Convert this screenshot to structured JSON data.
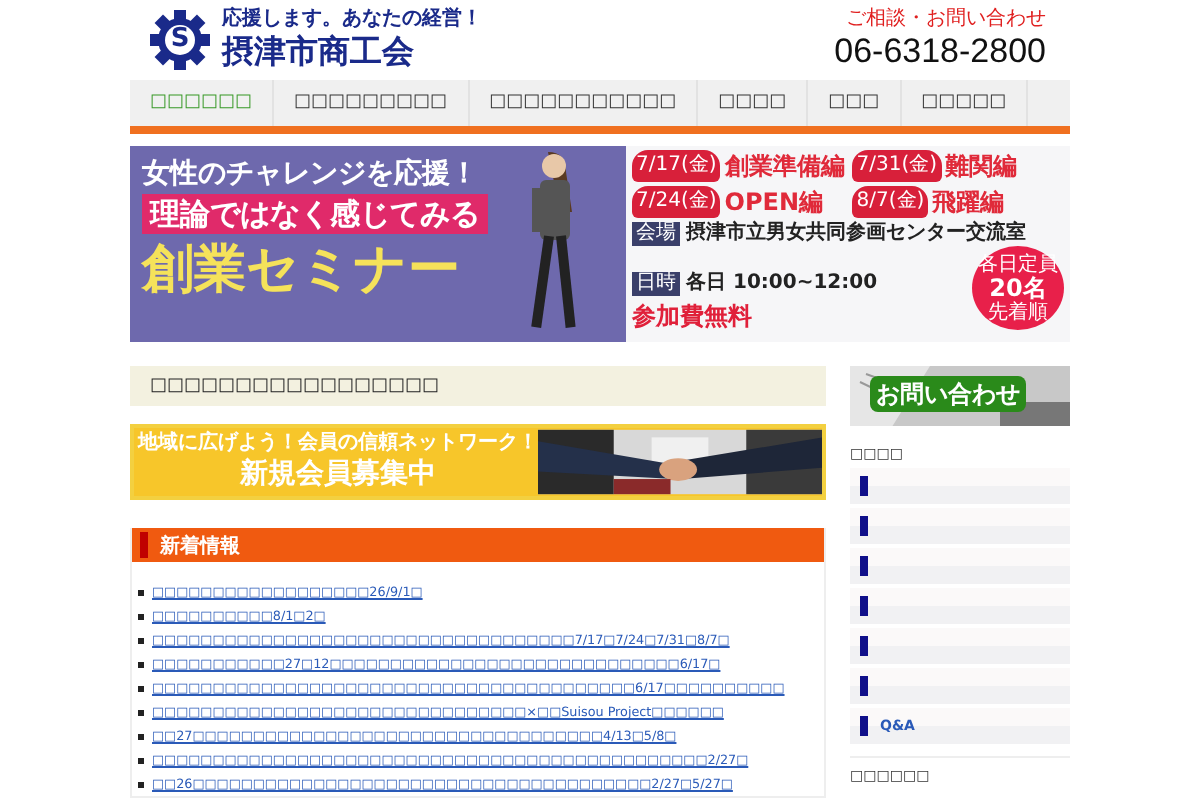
{
  "header": {
    "logo_mark": "S",
    "tagline": "応援します。あなたの経営！",
    "name": "摂津市商工会",
    "contact_label": "ご相談・お問い合わせ",
    "phone": "06-6318-2800"
  },
  "nav": [
    {
      "label": "□□□□□□",
      "selected": true
    },
    {
      "label": "□□□□□□□□□",
      "selected": false
    },
    {
      "label": "□□□□□□□□□□□",
      "selected": false
    },
    {
      "label": "□□□□",
      "selected": false
    },
    {
      "label": "□□□",
      "selected": false
    },
    {
      "label": "□□□□□",
      "selected": false
    }
  ],
  "seminar_banner": {
    "title_lines": [
      "女性のチャレンジを応援！",
      "理論ではなく感じてみる",
      "創業セミナー"
    ],
    "sessions": [
      {
        "date": "7/17(金)",
        "name": "創業準備編"
      },
      {
        "date": "7/31(金)",
        "name": "難関編"
      },
      {
        "date": "7/24(金)",
        "name": "OPEN編"
      },
      {
        "date": "8/7(金)",
        "name": "飛躍編"
      }
    ],
    "venue_label": "会場",
    "venue": "摂津市立男女共同参画センター交流室",
    "time_label": "日時",
    "time": "各日 10:00~12:00",
    "fee": "参加費無料",
    "capacity": [
      "各日定員",
      "20名",
      "先着順"
    ]
  },
  "page_title": "□□□□□□□□□□□□□□□□□",
  "member_banner": {
    "line_1": "地域に広げよう！会員の信頼ネットワーク！",
    "line_2": "新規会員募集中"
  },
  "news": {
    "heading": "新着情報",
    "items": [
      "□□□□□□□□□□□□□□□□□□26/9/1□",
      "□□□□□□□□□□8/1□2□",
      "□□□□□□□□□□□□□□□□□□□□□□□□□□□□□□□□□□□7/17□7/24□7/31□8/7□",
      "□□□□□□□□□□□27□12□□□□□□□□□□□□□□□□□□□□□□□□□□□□□6/17□",
      "□□□□□□□□□□□□□□□□□□□□□□□□□□□□□□□□□□□□□□□□6/17□□□□□□□□□□",
      "□□□□□□□□□□□□□□□□□□□□□□□□□□□□□□□×□□Suisou Project□□□□□□",
      "□□27□□□□□□□□□□□□□□□□□□□□□□□□□□□□□□□□□□4/13□5/8□",
      "□□□□□□□□□□□□□□□□□□□□□□□□□□□□□□□□□□□□□□□□□□□□□□2/27□",
      "□□26□□□□□□□□□□□□□□□□□□□□□□□□□□□□□□□□□□□□□□2/27□5/27□"
    ]
  },
  "sidebar": {
    "contact_button": "お問い合わせ",
    "menu_heading": "□□□□",
    "menu_items": [
      {
        "kind": "blank"
      },
      {
        "kind": "blank"
      },
      {
        "kind": "blank"
      },
      {
        "kind": "blank"
      },
      {
        "kind": "blank"
      },
      {
        "kind": "blank"
      },
      {
        "kind": "link",
        "label": "Q&A"
      }
    ],
    "second_heading": "□□□□□□"
  }
}
